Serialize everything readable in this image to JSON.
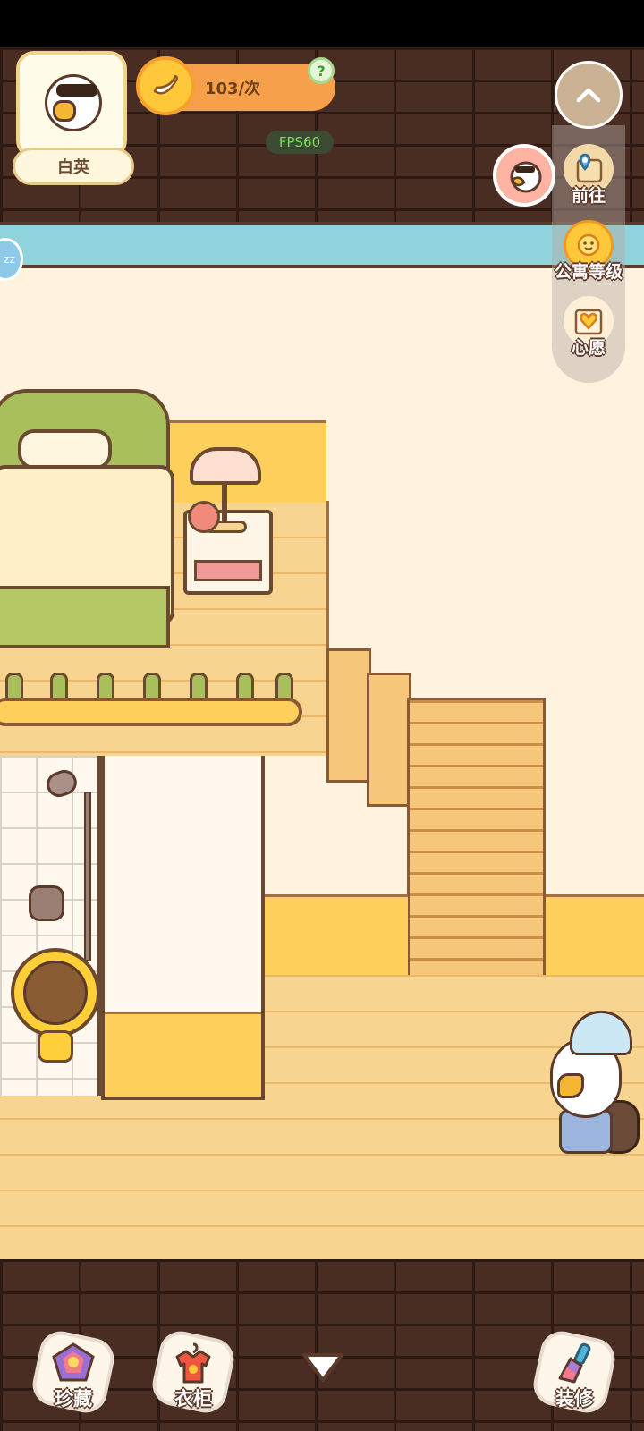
{
  "hud": {
    "player_name": "白英",
    "banana_count": "103/次",
    "help": "?",
    "fps": "FPS60",
    "sleep_tab": "zz"
  },
  "side_menu": {
    "goto_label": "前往",
    "apartment_level_label": "公寓等级",
    "wish_label": "心愿"
  },
  "bottom_bar": {
    "collection_label": "珍藏",
    "wardrobe_label": "衣柜",
    "decorate_label": "装修"
  },
  "icons": {
    "collapse": "chevron-up-icon",
    "expand": "chevron-down-icon",
    "banana": "banana-icon",
    "map": "map-pin-icon",
    "sun": "sun-badge-icon",
    "heart": "heart-book-icon"
  },
  "colors": {
    "banana_bar": "#f7a04b",
    "fps_text": "#77e059",
    "brick": "#4a2d22",
    "sky_strip": "#8fd3dc"
  }
}
